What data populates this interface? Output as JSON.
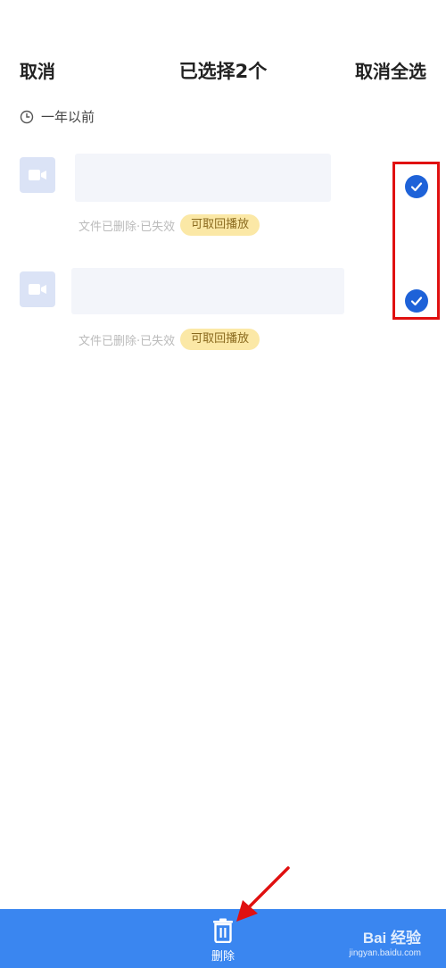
{
  "header": {
    "cancel_label": "取消",
    "title": "已选择2个",
    "deselect_all_label": "取消全选"
  },
  "section": {
    "label": "一年以前",
    "icon": "clock-icon"
  },
  "items": [
    {
      "icon": "video-camera-icon",
      "status_text": "文件已删除·已失效",
      "badge": "可取回播放",
      "selected": true
    },
    {
      "icon": "video-camera-icon",
      "status_text": "文件已删除·已失效",
      "badge": "可取回播放",
      "selected": true
    }
  ],
  "bottom_bar": {
    "delete_label": "删除",
    "delete_icon": "trash-icon",
    "watermark_text": "Bai 经验",
    "watermark_url": "jingyan.baidu.com"
  },
  "colors": {
    "accent": "#1e62d8",
    "bottom_bar": "#3a86f0",
    "badge_bg": "#fbe8a6",
    "annotation": "#e01010"
  }
}
